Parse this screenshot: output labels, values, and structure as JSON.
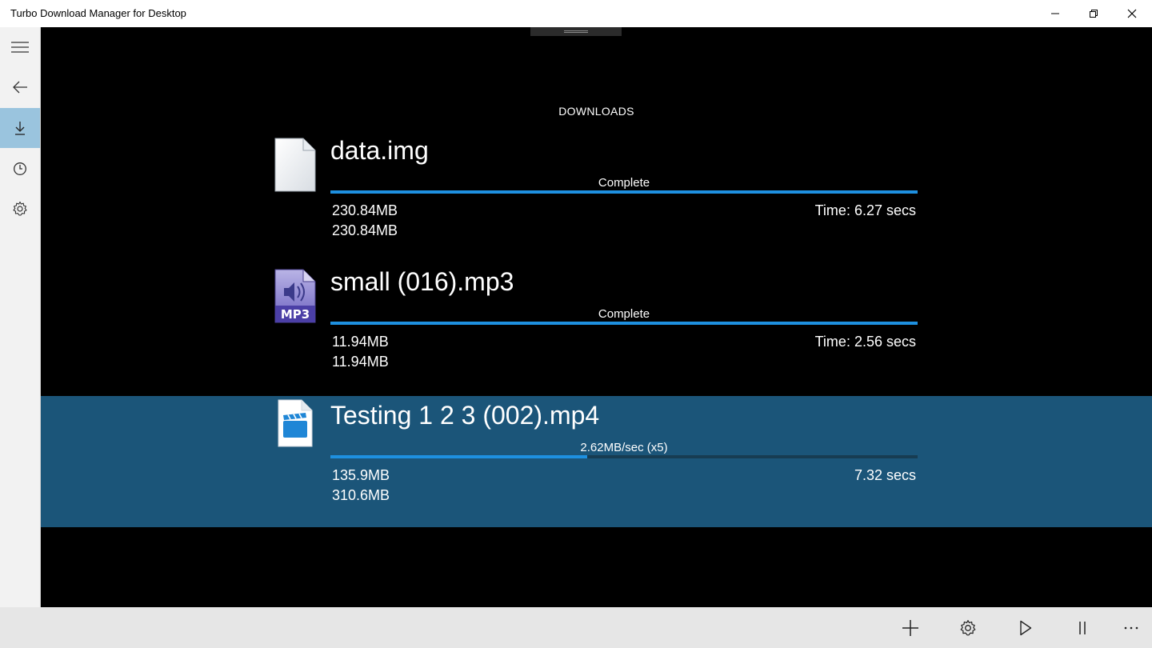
{
  "window": {
    "title": "Turbo Download Manager for Desktop"
  },
  "sidebar": {
    "items": [
      {
        "icon": "hamburger-menu-icon"
      },
      {
        "icon": "back-arrow-icon"
      },
      {
        "icon": "download-icon",
        "selected": true
      },
      {
        "icon": "clock-icon"
      },
      {
        "icon": "gear-icon"
      }
    ]
  },
  "main": {
    "section_title": "DOWNLOADS",
    "downloads": [
      {
        "name": "data.img",
        "icon": "generic-file-icon",
        "status": "Complete",
        "progress": 1.0,
        "downloaded": "230.84MB",
        "total": "230.84MB",
        "time": "Time: 6.27 secs",
        "selected": false
      },
      {
        "name": "small (016).mp3",
        "icon": "mp3-file-icon",
        "icon_label": "MP3",
        "status": "Complete",
        "progress": 1.0,
        "downloaded": "11.94MB",
        "total": "11.94MB",
        "time": "Time: 2.56 secs",
        "selected": false
      },
      {
        "name": "Testing 1 2 3 (002).mp4",
        "icon": "video-file-icon",
        "status": "2.62MB/sec (x5)",
        "progress": 0.4375,
        "downloaded": "135.9MB",
        "total": "310.6MB",
        "time": "7.32 secs",
        "selected": true
      }
    ]
  },
  "colors": {
    "selected_row": "#1b5579",
    "progress_fill": "#1e90e0",
    "nav_selected": "#9ac4de"
  },
  "bottombar": {
    "buttons": [
      "add-icon",
      "gear-icon",
      "play-icon",
      "pause-icon",
      "more-icon"
    ]
  }
}
